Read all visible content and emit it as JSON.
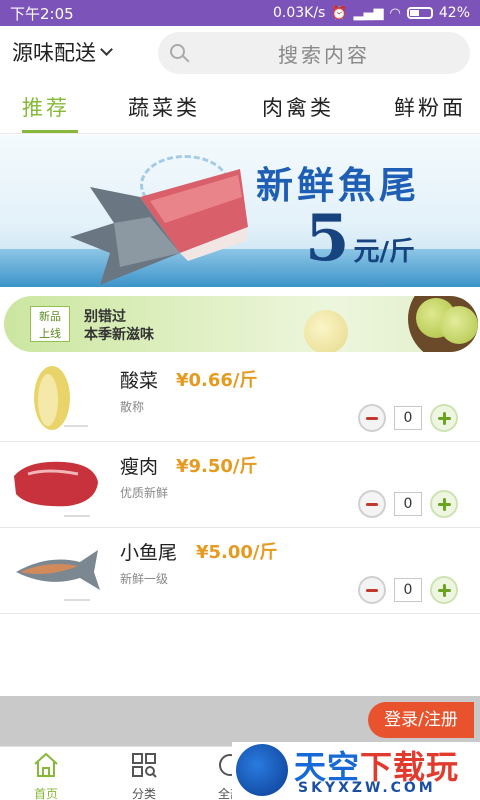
{
  "status_bar": {
    "time": "下午2:05",
    "network_speed": "0.03K/s",
    "battery": "42%"
  },
  "header": {
    "store_name": "源味配送",
    "search_placeholder": "搜索内容"
  },
  "tabs": [
    {
      "label": "推荐",
      "active": true
    },
    {
      "label": "蔬菜类",
      "active": false
    },
    {
      "label": "肉禽类",
      "active": false
    },
    {
      "label": "鲜粉面",
      "active": false
    }
  ],
  "banner": {
    "headline": "新鲜魚尾",
    "price_number": "5",
    "price_unit": "元/斤"
  },
  "promo": {
    "tag_line1": "新品",
    "tag_line2": "上线",
    "text_line1": "别错过",
    "text_line2": "本季新滋味"
  },
  "products": [
    {
      "name": "酸菜",
      "price": "¥0.66/斤",
      "desc": "散称",
      "qty": "0"
    },
    {
      "name": "瘦肉",
      "price": "¥9.50/斤",
      "desc": "优质新鲜",
      "qty": "0"
    },
    {
      "name": "小鱼尾",
      "price": "¥5.00/斤",
      "desc": "新鲜一级",
      "qty": "0"
    }
  ],
  "login_button": "登录/注册",
  "bottom_nav": [
    {
      "label": "首页",
      "icon": "home-icon",
      "active": true
    },
    {
      "label": "分类",
      "icon": "category-icon",
      "active": false
    },
    {
      "label": "全部",
      "icon": "all-icon",
      "active": false
    }
  ],
  "watermark": {
    "title_blue": "天空",
    "title_red": "下载玩",
    "url": "SKYXZW.COM"
  },
  "colors": {
    "status_bar": "#7c54b9",
    "accent_green": "#86b93a",
    "price_orange": "#e69a1f",
    "login_red": "#e8522c"
  }
}
